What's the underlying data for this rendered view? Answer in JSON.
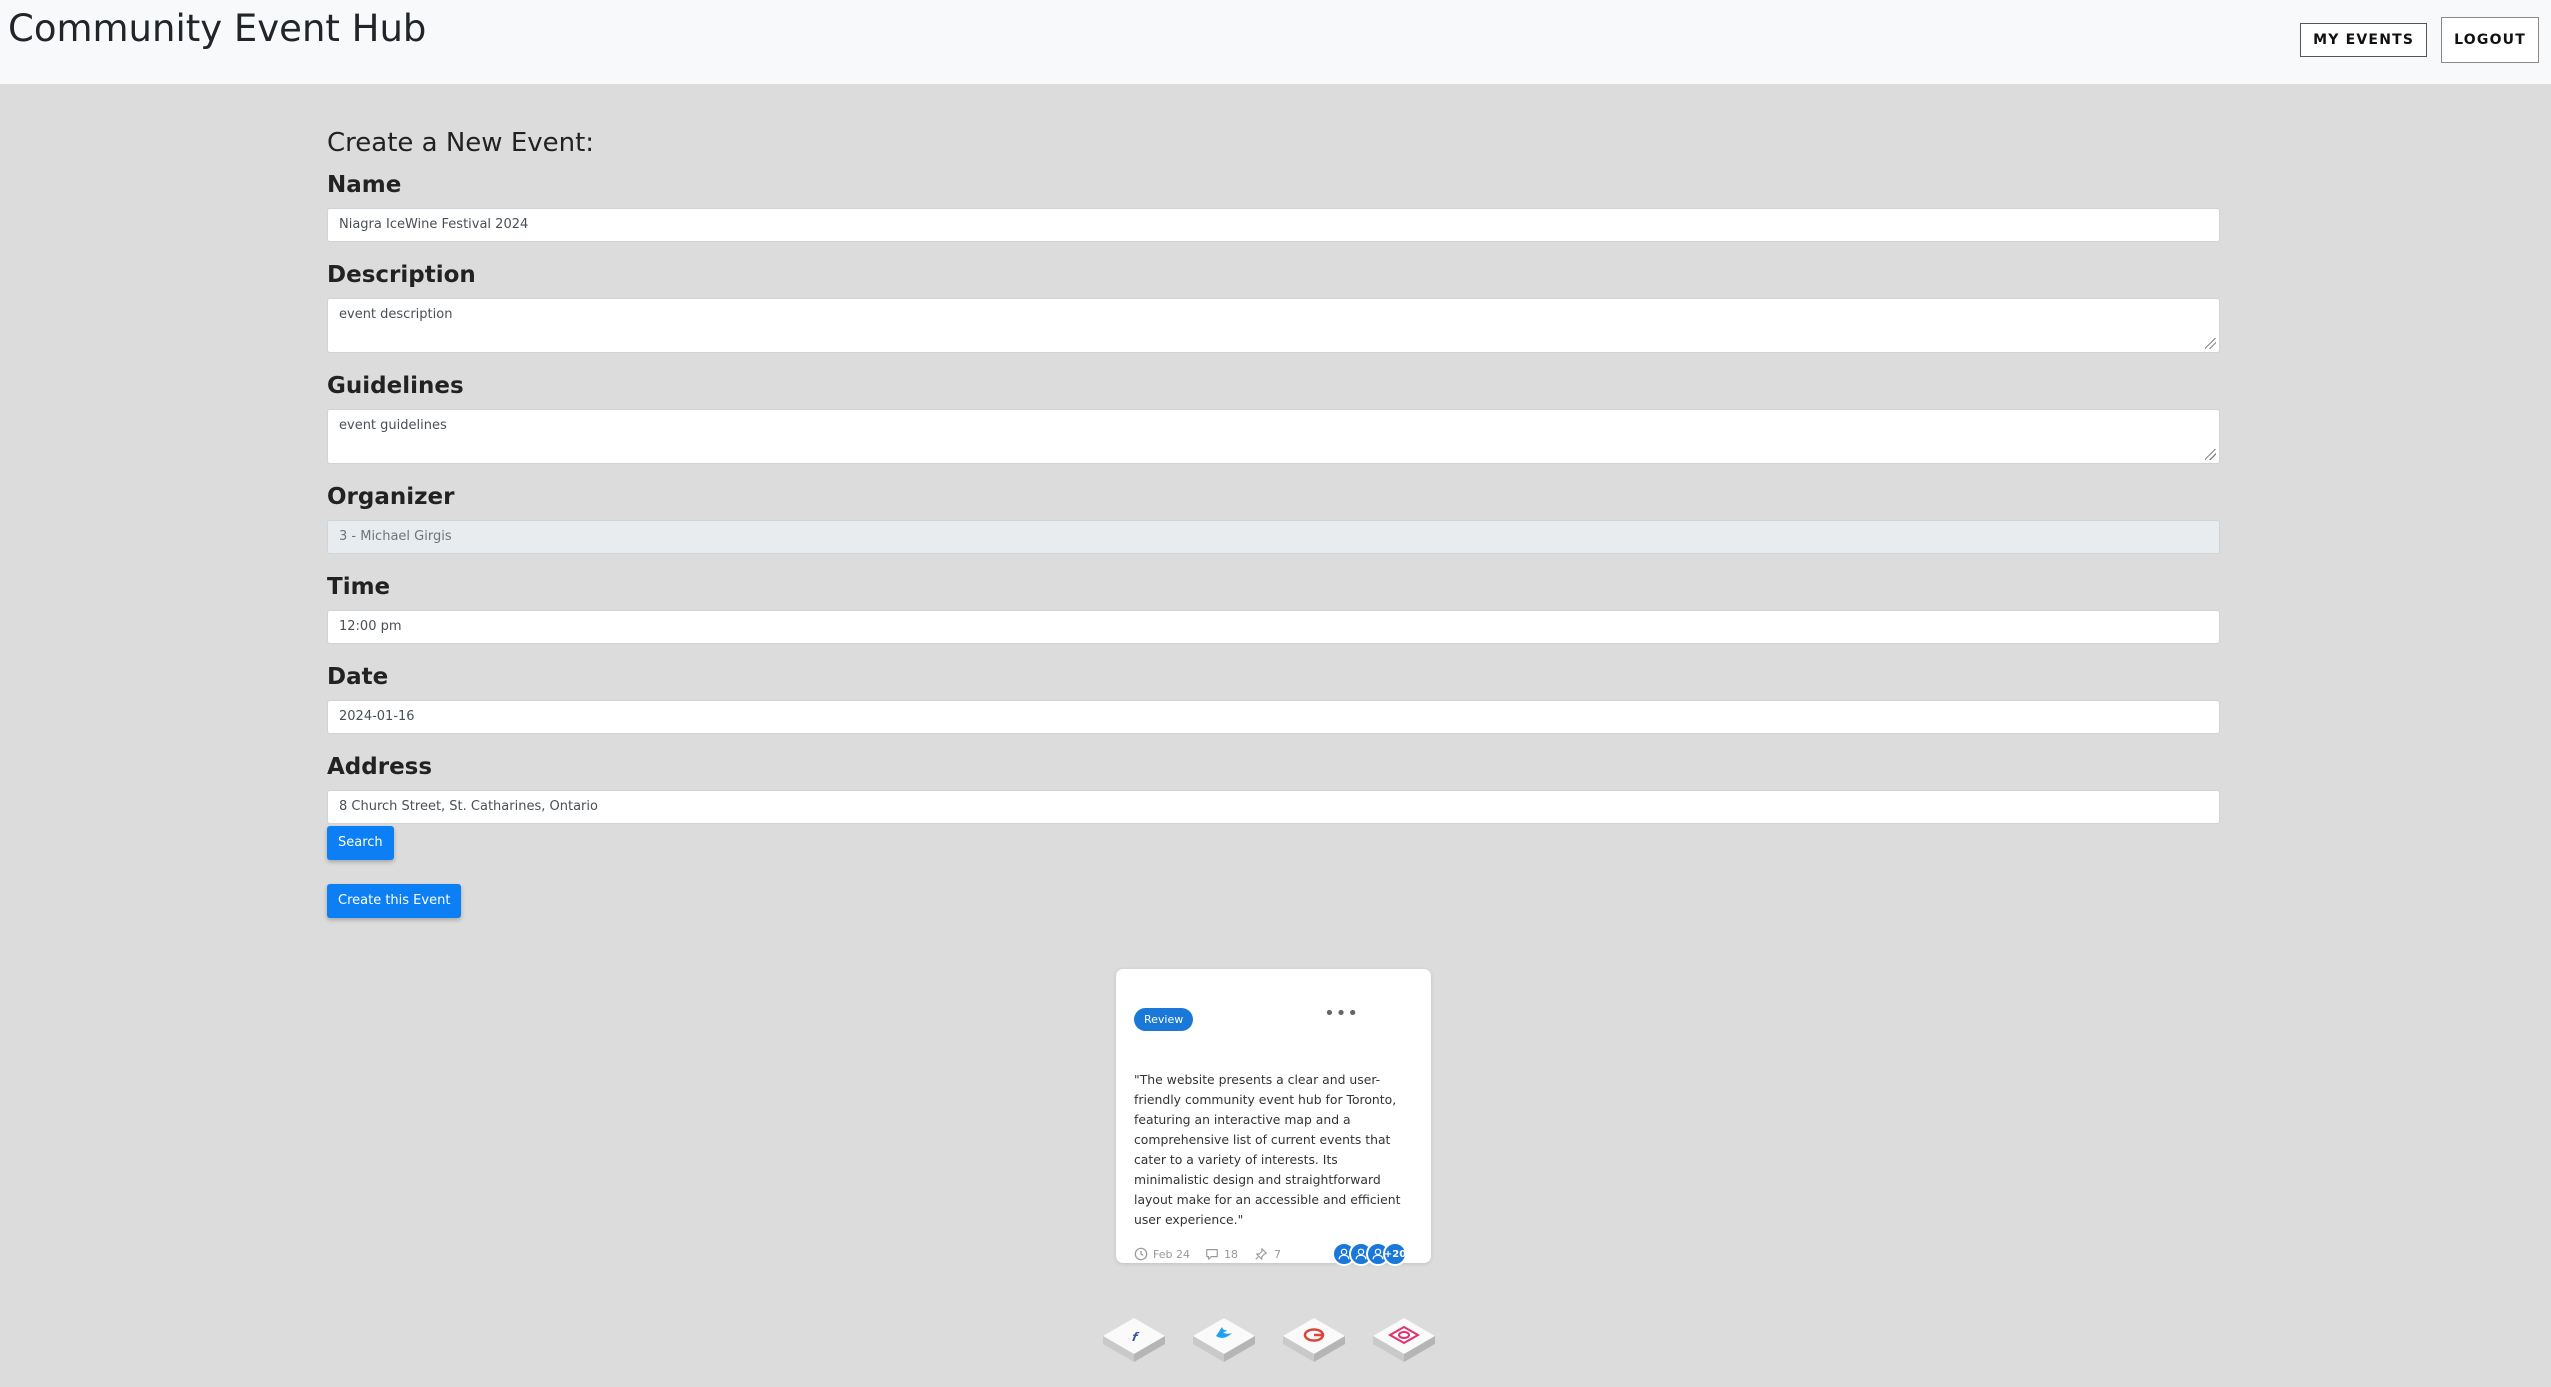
{
  "header": {
    "brand": "Community Event Hub",
    "my_events_label": "MY EVENTS",
    "logout_label": "LOGOUT"
  },
  "form": {
    "title": "Create a New Event:",
    "name": {
      "label": "Name",
      "value": "Niagra IceWine Festival 2024"
    },
    "description": {
      "label": "Description",
      "value": "event description"
    },
    "guidelines": {
      "label": "Guidelines",
      "value": "event guidelines"
    },
    "organizer": {
      "label": "Organizer",
      "value": "3 - Michael Girgis"
    },
    "time": {
      "label": "Time",
      "value": "12:00 pm"
    },
    "date": {
      "label": "Date",
      "value": "2024-01-16"
    },
    "address": {
      "label": "Address",
      "value": "8 Church Street, St. Catharines, Ontario"
    },
    "search_label": "Search",
    "create_label": "Create this Event"
  },
  "review_card": {
    "badge": "Review",
    "menu": "•••",
    "quote": "\"The website presents a clear and user-friendly community event hub for Toronto, featuring an interactive map and a comprehensive list of current events that cater to a variety of interests. Its minimalistic design and straightforward layout make for an accessible and efficient user experience.\"",
    "date": "Feb 24",
    "comments": "18",
    "pins": "7",
    "avatars_more": "+20",
    "accent": "#1a78d9"
  },
  "socials": [
    {
      "name": "facebook-icon",
      "color": "#3b5998"
    },
    {
      "name": "twitter-icon",
      "color": "#1da1f2"
    },
    {
      "name": "google-icon",
      "color": "#db4437"
    },
    {
      "name": "instagram-icon",
      "color": "#e1306c"
    }
  ],
  "colors": {
    "primary": "#0d7ff5",
    "background": "#dcdcdc",
    "header_bg": "#f8f9fa"
  }
}
